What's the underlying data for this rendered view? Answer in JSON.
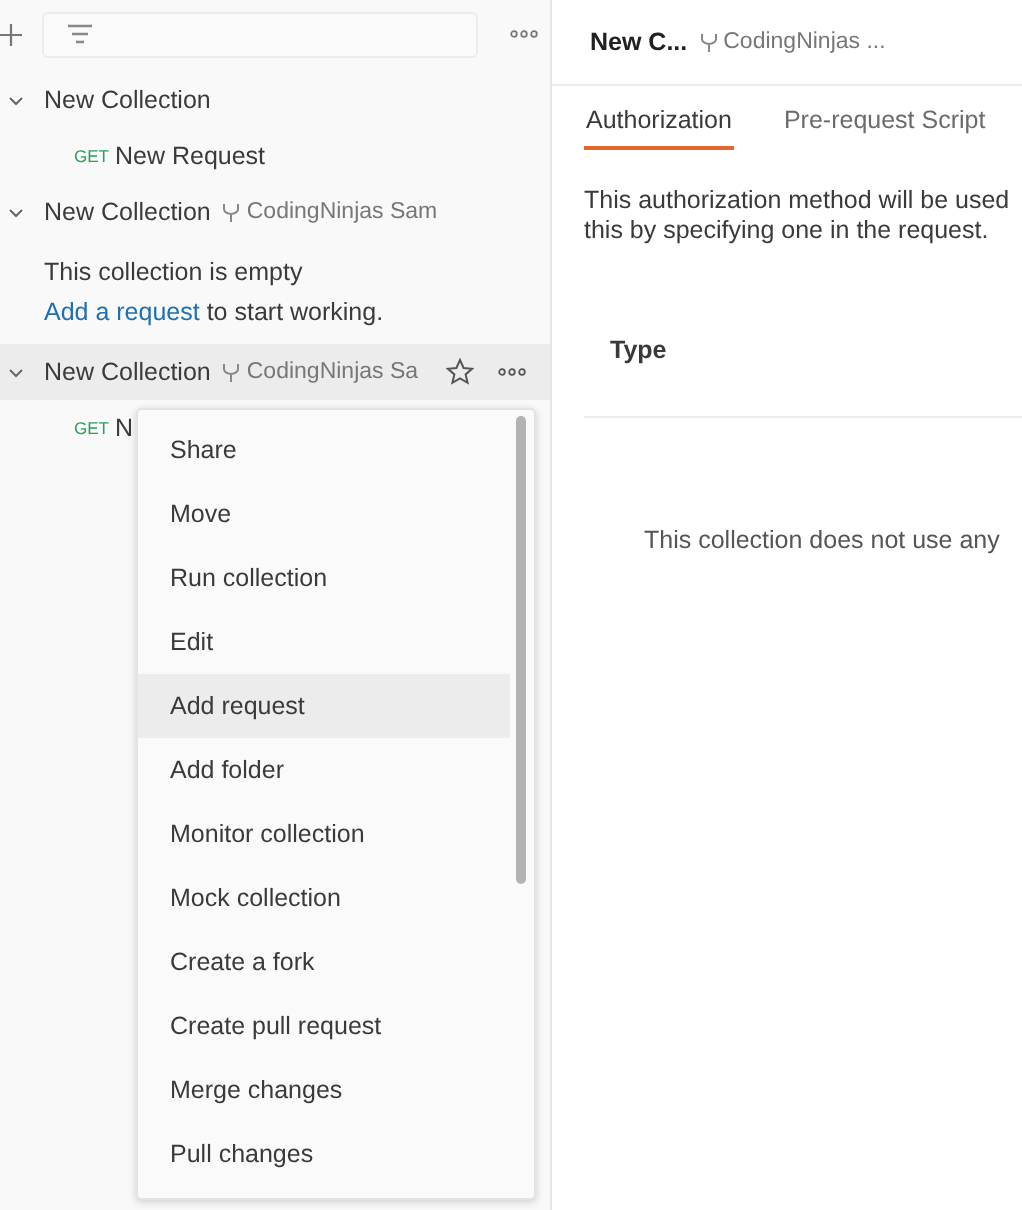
{
  "sidebar": {
    "collections": [
      {
        "name": "New Collection",
        "expanded": true,
        "hovered": false,
        "requests": [
          {
            "method": "GET",
            "name": "New Request"
          }
        ]
      },
      {
        "name": "New Collection",
        "fork": "CodingNinjas Sam",
        "expanded": true,
        "hovered": false,
        "empty": {
          "message": "This collection is empty",
          "link": "Add a request",
          "rest": "to start working."
        }
      },
      {
        "name": "New Collection",
        "fork": "CodingNinjas Sa",
        "expanded": true,
        "hovered": true,
        "requests": [
          {
            "method": "GET",
            "name": "N"
          }
        ]
      }
    ]
  },
  "menu": {
    "items": [
      {
        "label": "Share",
        "selected": false
      },
      {
        "label": "Move",
        "selected": false
      },
      {
        "label": "Run collection",
        "selected": false
      },
      {
        "label": "Edit",
        "selected": false
      },
      {
        "label": "Add request",
        "selected": true
      },
      {
        "label": "Add folder",
        "selected": false
      },
      {
        "label": "Monitor collection",
        "selected": false
      },
      {
        "label": "Mock collection",
        "selected": false
      },
      {
        "label": "Create a fork",
        "selected": false
      },
      {
        "label": "Create pull request",
        "selected": false
      },
      {
        "label": "Merge changes",
        "selected": false
      },
      {
        "label": "Pull changes",
        "selected": false
      }
    ]
  },
  "main": {
    "title": "New C...",
    "fork": "CodingNinjas ...",
    "tabs": [
      {
        "label": "Authorization",
        "selected": true
      },
      {
        "label": "Pre-request Script",
        "selected": false
      }
    ],
    "description": [
      "This authorization method will be used",
      "this by specifying one in the request."
    ],
    "type_label": "Type",
    "empty_message": "This collection does not use any"
  }
}
